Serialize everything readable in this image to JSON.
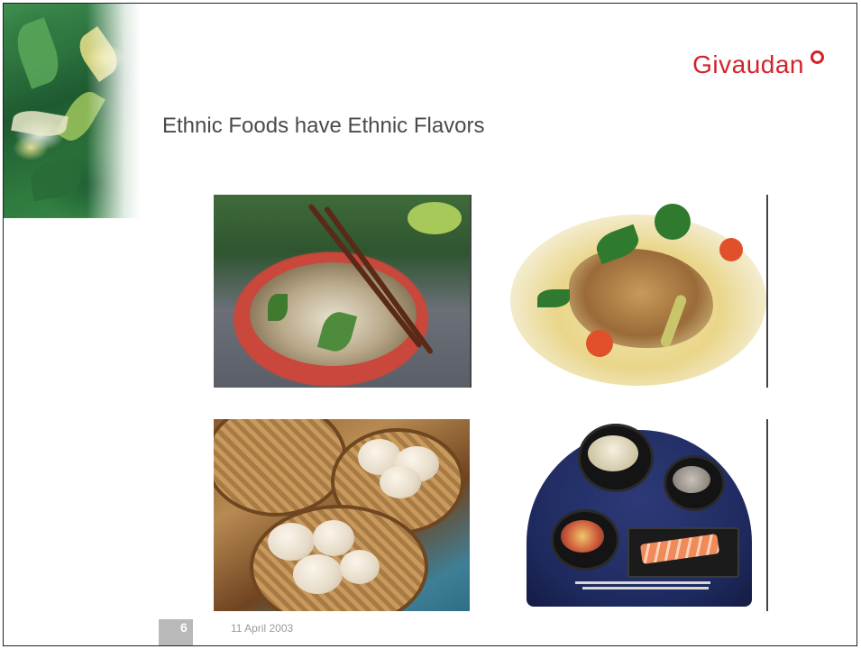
{
  "slide": {
    "brand": "Givaudan",
    "title": "Ethnic Foods have Ethnic Flavors",
    "page_number": "6",
    "date": "11 April 2003"
  },
  "images": [
    {
      "name": "pho-noodle-soup-photo"
    },
    {
      "name": "thai-curry-photo"
    },
    {
      "name": "dim-sum-photo"
    },
    {
      "name": "japanese-bento-photo"
    },
    {
      "name": "flower-leaves-photo"
    }
  ],
  "colors": {
    "brand_red": "#d2232a",
    "title_gray": "#4a4a4a",
    "footer_box": "#b9b9b9",
    "footer_text": "#9a9a9a"
  }
}
